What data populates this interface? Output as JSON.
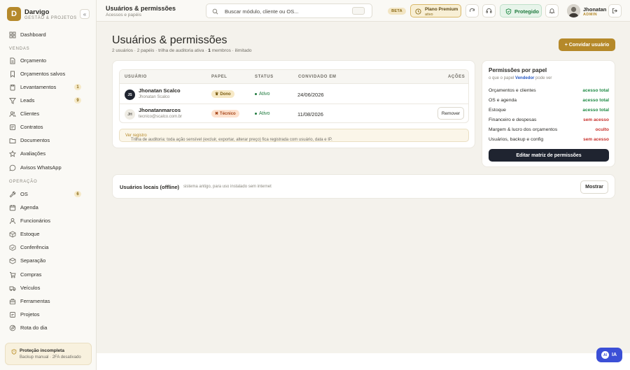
{
  "brand": {
    "initial": "D",
    "name": "Darvigo",
    "subtitle": "GESTÃO & PROJETOS",
    "collapse_glyph": "«"
  },
  "sidebar": {
    "items_top": [
      {
        "label": "Dashboard",
        "icon": "grid-icon"
      }
    ],
    "sections": [
      {
        "title": "VENDAS",
        "items": [
          {
            "label": "Orçamento",
            "icon": "document-icon"
          },
          {
            "label": "Orçamentos salvos",
            "icon": "bookmark-icon"
          },
          {
            "label": "Levantamentos",
            "icon": "clipboard-icon",
            "badge": "1"
          },
          {
            "label": "Leads",
            "icon": "filter-icon",
            "badge": "9"
          },
          {
            "label": "Clientes",
            "icon": "users-icon"
          },
          {
            "label": "Contratos",
            "icon": "contract-icon"
          },
          {
            "label": "Documentos",
            "icon": "folder-icon"
          },
          {
            "label": "Avaliações",
            "icon": "star-icon"
          },
          {
            "label": "Avisos WhatsApp",
            "icon": "chat-icon"
          }
        ]
      },
      {
        "title": "OPERAÇÃO",
        "items": [
          {
            "label": "OS",
            "icon": "wrench-icon",
            "badge": "6"
          },
          {
            "label": "Agenda",
            "icon": "calendar-icon"
          },
          {
            "label": "Funcionários",
            "icon": "person-icon"
          },
          {
            "label": "Estoque",
            "icon": "box-icon"
          },
          {
            "label": "Conferência",
            "icon": "check-box-icon"
          },
          {
            "label": "Separação",
            "icon": "split-icon"
          },
          {
            "label": "Compras",
            "icon": "cart-icon"
          },
          {
            "label": "Veículos",
            "icon": "truck-icon"
          },
          {
            "label": "Ferramentas",
            "icon": "tools-icon"
          },
          {
            "label": "Projetos",
            "icon": "project-icon"
          },
          {
            "label": "Rota do dia",
            "icon": "route-icon"
          }
        ]
      }
    ],
    "protection": {
      "title": "Proteção incompleta",
      "subtitle": "Backup manual · 2FA desativado"
    }
  },
  "topbar": {
    "title": "Usuários & permissões",
    "breadcrumb": "Acessos e papéis",
    "search_placeholder": "Buscar módulo, cliente ou OS...",
    "beta_label": "BETA",
    "plan": {
      "title": "Plano Premium",
      "status": "ativo"
    },
    "protected_label": "Protegido",
    "user": {
      "name": "Jhonatan",
      "role": "ADMIN"
    }
  },
  "main": {
    "title": "Usuários & permissões",
    "summary": {
      "counts": "2 usuários · 2 papéis · trilha de auditoria ativa · ",
      "members_num": "1",
      "members_rest": " membros · ilimitado"
    },
    "invite_label": "+ Convidar usuário",
    "table": {
      "headers": [
        "USUÁRIO",
        "PAPEL",
        "STATUS",
        "CONVIDADO EM",
        "AÇÕES"
      ],
      "rows": [
        {
          "initials": "JS",
          "name": "Jhonatan Scalco",
          "email": "Jhonatan Scalco",
          "role": "Dono",
          "role_glyph": "♛",
          "status": "Ativo",
          "invited": "24/06/2026",
          "action": ""
        },
        {
          "initials": "JH",
          "name": "Jhonatanmarcos",
          "email": "tecnico@scalco.com.br",
          "role": "Técnico",
          "role_glyph": "✖",
          "status": "Ativo",
          "invited": "11/08/2026",
          "action": "Remover"
        }
      ]
    },
    "audit": {
      "text": "Trilha de auditoria: toda ação sensível (excluir, exportar, alterar preço) fica registrada com usuário, data e IP. ",
      "link": "Ver registro"
    },
    "permissions": {
      "title": "Permissões por papel",
      "sub_prefix": "o que o papel ",
      "role": "Vendedor",
      "sub_suffix": " pode ver",
      "rows": [
        {
          "area": "Orçamentos e clientes",
          "access": "acesso total",
          "level": "ok"
        },
        {
          "area": "OS e agenda",
          "access": "acesso total",
          "level": "ok"
        },
        {
          "area": "Estoque",
          "access": "acesso total",
          "level": "ok"
        },
        {
          "area": "Financeiro e despesas",
          "access": "sem acesso",
          "level": "no"
        },
        {
          "area": "Margem & lucro dos orçamentos",
          "access": "oculto",
          "level": "no"
        },
        {
          "area": "Usuários, backup e config",
          "access": "sem acesso",
          "level": "no"
        }
      ],
      "edit_label": "Editar matriz de permissões"
    },
    "offline": {
      "title": "Usuários locais (offline)",
      "subtitle": "sistema antigo, para uso instalado sem internet",
      "button": "Mostrar"
    }
  },
  "assistant": {
    "badge": "AI",
    "label": "IA"
  }
}
